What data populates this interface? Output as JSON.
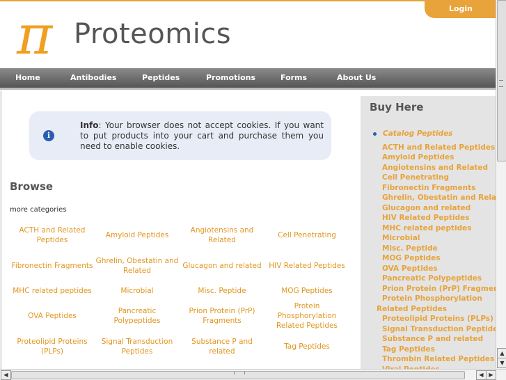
{
  "header": {
    "logo_symbol": "π",
    "logo_text": "Proteomics",
    "login_label": "Login"
  },
  "nav": [
    "Home",
    "Antibodies",
    "Peptides",
    "Promotions",
    "Forms",
    "About Us"
  ],
  "info": {
    "label": "Info",
    "message": ": Your browser does not accept cookies. If you want to put products into your cart and purchase them you need to enable cookies."
  },
  "browse": {
    "title": "Browse",
    "more_categories": "more categories",
    "categories": [
      "ACTH and Related Peptides",
      "Amyloid Peptides",
      "Angiotensins and Related",
      "Cell Penetrating",
      "Fibronectin Fragments",
      "Ghrelin, Obestatin and Related",
      "Glucagon and related",
      "HIV Related Peptides",
      "MHC related peptides",
      "Microbial",
      "Misc. Peptide",
      "MOG Peptides",
      "OVA Peptides",
      "Pancreatic Polypeptides",
      "Prion Protein (PrP) Fragments",
      "Protein Phosphorylation Related Peptides",
      "Proteolipid Proteins (PLPs)",
      "Signal Transduction Peptides",
      "Substance P and related",
      "Tag Peptides"
    ]
  },
  "sidebar": {
    "heading": "Buy Here",
    "top_link": "Catalog Peptides",
    "items": [
      "ACTH and Related Peptides",
      "Amyloid Peptides",
      "Angiotensins and Related",
      "Cell Penetrating",
      "Fibronectin Fragments",
      "Ghrelin, Obestatin and Related",
      "Glucagon and related",
      "HIV Related Peptides",
      "MHC related peptides",
      "Microbial",
      "Misc. Peptide",
      "MOG Peptides",
      "OVA Peptides",
      "Pancreatic Polypeptides",
      "Prion Protein (PrP) Fragments",
      "Protein Phosphorylation",
      "Related Peptides",
      "Proteolipid Proteins (PLPs)",
      "Signal Transduction Peptides",
      "Substance P and related",
      "Tag Peptides",
      "Thrombin Related Peptides",
      "Viral Peptides"
    ]
  },
  "icons": {
    "info": "info-icon",
    "scroll_up": "▲",
    "scroll_down": "▼",
    "scroll_left": "◀",
    "scroll_right": "▶"
  },
  "colors": {
    "accent": "#e8a33a",
    "link": "#e0961e",
    "nav_bg": "#6e6e6e",
    "sidebar_bg": "#e4e4e4",
    "info_bg": "#e8ecf7"
  }
}
